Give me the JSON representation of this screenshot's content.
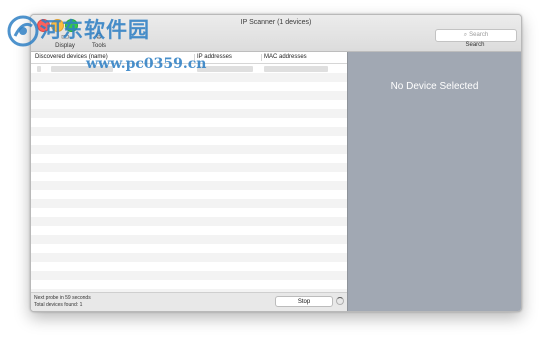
{
  "window": {
    "title": "IP Scanner (1 devices)"
  },
  "toolbar": {
    "display_label": "Display",
    "tools_label": "Tools",
    "display_icon": "display-icon",
    "tools_icon": "tools-icon"
  },
  "search": {
    "placeholder": "Search",
    "label": "Search"
  },
  "table": {
    "columns": [
      "Discovered devices (name)",
      "IP addresses",
      "MAC addresses"
    ],
    "rows": [
      {
        "name": "",
        "ip": "",
        "mac": ""
      }
    ]
  },
  "status": {
    "next_probe": "Next probe in 59 seconds",
    "total_found": "Total devices found: 1",
    "stop_label": "Stop"
  },
  "detail": {
    "empty_text": "No Device Selected"
  },
  "watermark": {
    "site_name": "河东软件园",
    "url": "www.pc0359.cn"
  },
  "colors": {
    "sidebar_bg": "#a1a8b3",
    "watermark": "#2f80c4"
  }
}
